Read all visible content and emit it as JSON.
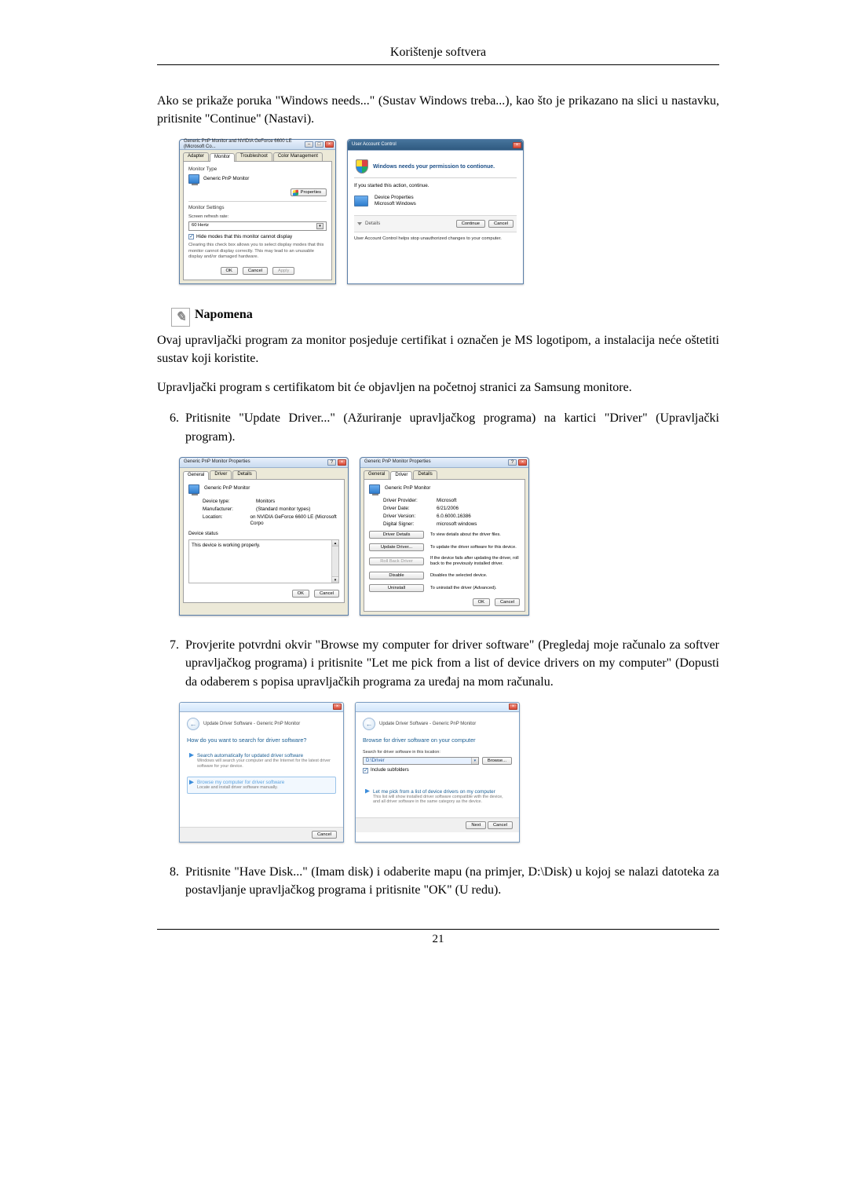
{
  "section_header": "Korištenje softvera",
  "page_number": "21",
  "para1": "Ako se prikaže poruka \"Windows needs...\" (Sustav Windows treba...), kao što je prikazano na slici u nastavku, pritisnite \"Continue\" (Nastavi).",
  "note": {
    "label": "Napomena"
  },
  "para2": "Ovaj upravljački program za monitor posjeduje certifikat i označen je MS logotipom, a instalacija neće oštetiti sustav koji koristite.",
  "para3": "Upravljački program s certifikatom bit će objavljen na početnoj stranici za Samsung monitore.",
  "step6": {
    "num": "6.",
    "text": "Pritisnite \"Update Driver...\" (Ažuriranje upravljačkog programa) na kartici \"Driver\" (Upravljački program)."
  },
  "step7": {
    "num": "7.",
    "text": "Provjerite potvrdni okvir \"Browse my computer for driver software\" (Pregledaj moje računalo za softver upravljačkog programa) i pritisnite \"Let me pick from a list of device drivers on my computer\" (Dopusti da odaberem s popisa upravljačkih programa za uređaj na mom računalu."
  },
  "step8": {
    "num": "8.",
    "text": "Pritisnite \"Have Disk...\" (Imam disk) i odaberite mapu (na primjer, D:\\Disk) u kojoj se nalazi datoteka za postavljanje upravljačkog programa i pritisnite \"OK\" (U redu)."
  },
  "fig1": {
    "title": "Generic PnP Monitor and NVIDIA GeForce 6600 LE (Microsoft Co...",
    "tabs": [
      "Adapter",
      "Monitor",
      "Troubleshoot",
      "Color Management"
    ],
    "active_tab_idx": 1,
    "section_monitor_type": "Monitor Type",
    "monitor_name": "Generic PnP Monitor",
    "btn_properties": "Properties",
    "section_monitor_settings": "Monitor Settings",
    "refresh_label": "Screen refresh rate:",
    "refresh_value": "60 Hertz",
    "chk_label": "Hide modes that this monitor cannot display",
    "chk_desc": "Clearing this check box allows you to select display modes that this monitor cannot display correctly. This may lead to an unusable display and/or damaged hardware.",
    "ok": "OK",
    "cancel": "Cancel",
    "apply": "Apply"
  },
  "fig2": {
    "title": "User Account Control",
    "msg": "Windows needs your permission to contionue.",
    "sub": "If you started this action, continue.",
    "prog_name": "Device Properties",
    "prog_pub": "Microsoft Windows",
    "details": "Details",
    "continue": "Continue",
    "cancel": "Cancel",
    "footer": "User Account Control helps stop unauthorized changes to your computer."
  },
  "fig3": {
    "title": "Generic PnP Monitor Properties",
    "tabs": [
      "General",
      "Driver",
      "Details"
    ],
    "active_tab_idx": 0,
    "monitor_name": "Generic PnP Monitor",
    "kv": [
      {
        "k": "Device type:",
        "v": "Monitors"
      },
      {
        "k": "Manufacturer:",
        "v": "(Standard monitor types)"
      },
      {
        "k": "Location:",
        "v": "on NVIDIA GeForce 6600 LE (Microsoft Corpo"
      }
    ],
    "status_label": "Device status",
    "status_text": "This device is working properly.",
    "ok": "OK",
    "cancel": "Cancel"
  },
  "fig4": {
    "title": "Generic PnP Monitor Properties",
    "tabs": [
      "General",
      "Driver",
      "Details"
    ],
    "active_tab_idx": 1,
    "monitor_name": "Generic PnP Monitor",
    "kv": [
      {
        "k": "Driver Provider:",
        "v": "Microsoft"
      },
      {
        "k": "Driver Date:",
        "v": "6/21/2006"
      },
      {
        "k": "Driver Version:",
        "v": "6.0.6000.16386"
      },
      {
        "k": "Digital Signer:",
        "v": "microsoft windows"
      }
    ],
    "buttons": [
      {
        "label": "Driver Details",
        "desc": "To view details about the driver files.",
        "disabled": false,
        "name": "driver-details-button"
      },
      {
        "label": "Update Driver...",
        "desc": "To update the driver software for this device.",
        "disabled": false,
        "name": "update-driver-button"
      },
      {
        "label": "Roll Back Driver",
        "desc": "If the device fails after updating the driver, roll back to the previously installed driver.",
        "disabled": true,
        "name": "rollback-driver-button"
      },
      {
        "label": "Disable",
        "desc": "Disables the selected device.",
        "disabled": false,
        "name": "disable-button"
      },
      {
        "label": "Uninstall",
        "desc": "To uninstall the driver (Advanced).",
        "disabled": false,
        "name": "uninstall-button"
      }
    ],
    "ok": "OK",
    "cancel": "Cancel"
  },
  "fig5": {
    "breadcrumb": "Update Driver Software - Generic PnP Monitor",
    "title": "How do you want to search for driver software?",
    "opt1": {
      "head": "Search automatically for updated driver software",
      "sub": "Windows will search your computer and the Internet for the latest driver software for your device."
    },
    "opt2": {
      "head": "Browse my computer for driver software",
      "sub": "Locate and install driver software manually."
    },
    "cancel": "Cancel"
  },
  "fig6": {
    "breadcrumb": "Update Driver Software - Generic PnP Monitor",
    "title": "Browse for driver software on your computer",
    "loc_label": "Search for driver software in this location:",
    "loc_value": "D:\\Driver",
    "browse": "Browse...",
    "chk": "Include subfolders",
    "link": {
      "head": "Let me pick from a list of device drivers on my computer",
      "sub": "This list will show installed driver software compatible with the device, and all driver software in the same category as the device."
    },
    "next": "Next",
    "cancel": "Cancel"
  }
}
